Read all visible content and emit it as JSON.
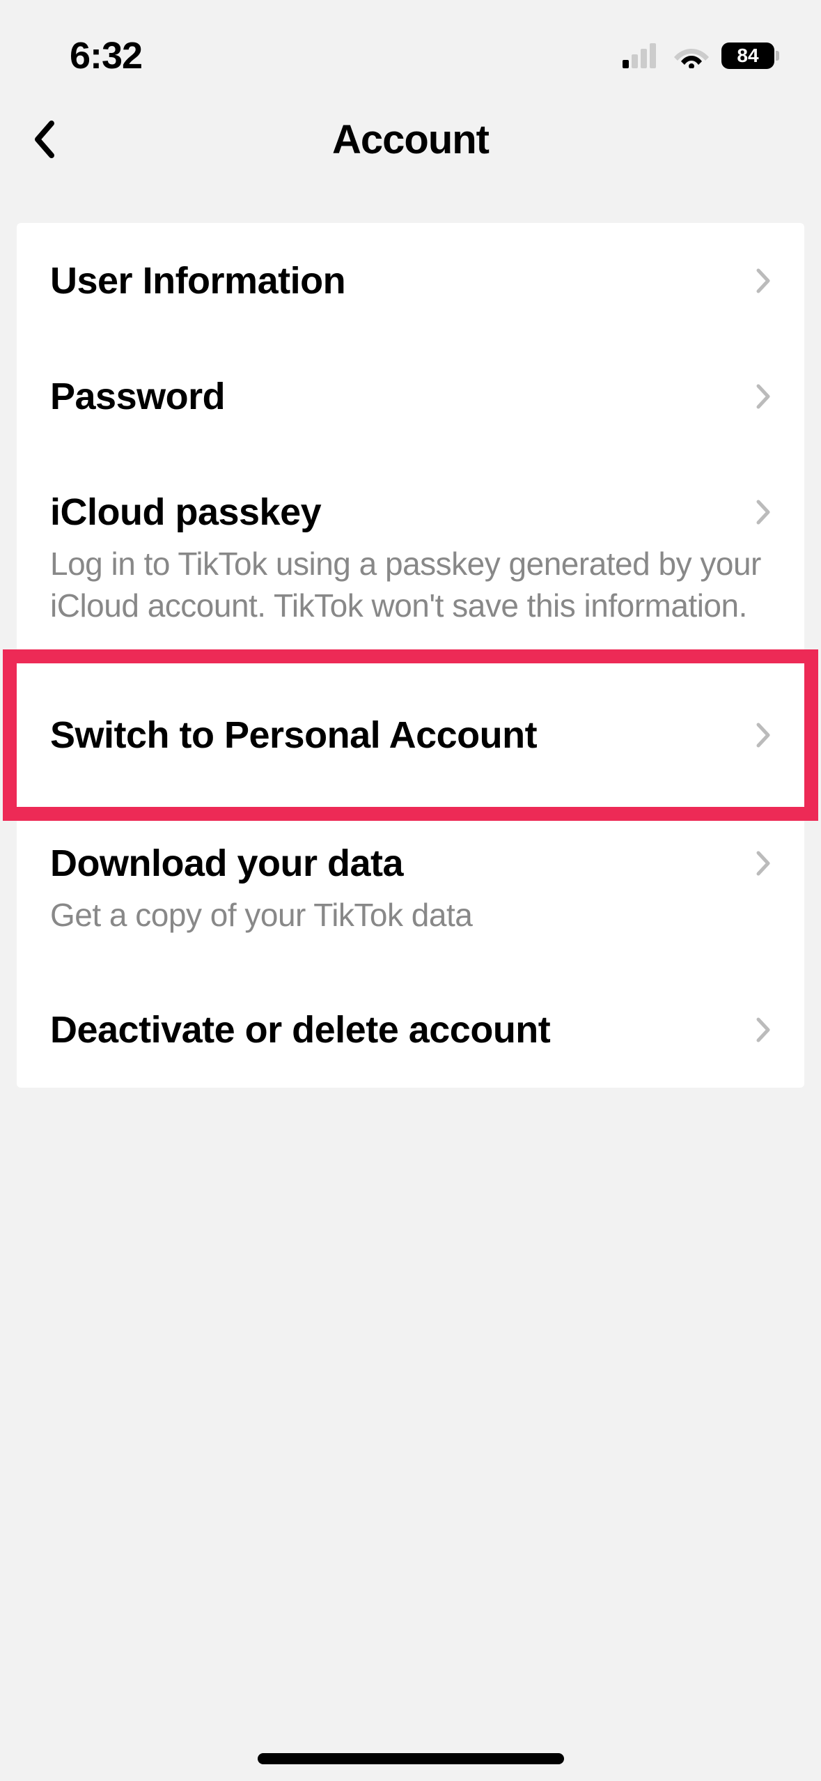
{
  "status_bar": {
    "time": "6:32",
    "battery": "84"
  },
  "header": {
    "title": "Account"
  },
  "rows": {
    "user_info": {
      "label": "User Information"
    },
    "password": {
      "label": "Password"
    },
    "icloud": {
      "label": "iCloud passkey",
      "sublabel": "Log in to TikTok using a passkey generated by your iCloud account. TikTok won't save this information."
    },
    "switch": {
      "label": "Switch to Personal Account"
    },
    "download": {
      "label": "Download your data",
      "sublabel": "Get a copy of your TikTok data"
    },
    "deactivate": {
      "label": "Deactivate or delete account"
    }
  }
}
